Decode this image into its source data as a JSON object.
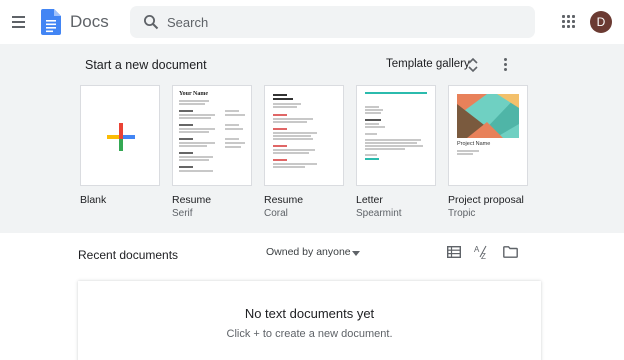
{
  "header": {
    "app_name": "Docs",
    "search_placeholder": "Search",
    "avatar_letter": "D",
    "avatar_color": "#6b3a32"
  },
  "templates": {
    "title": "Start a new document",
    "gallery_label": "Template gallery",
    "items": [
      {
        "name": "Blank",
        "sub": ""
      },
      {
        "name": "Resume",
        "sub": "Serif"
      },
      {
        "name": "Resume",
        "sub": "Coral"
      },
      {
        "name": "Letter",
        "sub": "Spearmint"
      },
      {
        "name": "Project proposal",
        "sub": "Tropic"
      }
    ],
    "thumb_text": {
      "resume_serif_name": "Your Name",
      "proposal_title": "Project Name"
    }
  },
  "recent": {
    "title": "Recent documents",
    "owner_filter": "Owned by anyone",
    "empty_title": "No text documents yet",
    "empty_sub": "Click + to create a new document."
  },
  "colors": {
    "accent_blue": "#4285f4",
    "accent_red": "#ea4335",
    "accent_yellow": "#fbbc04",
    "accent_green": "#34a853",
    "coral": "#e06666",
    "spearmint": "#2bbbad"
  },
  "icons": [
    "menu-icon",
    "docs-logo-icon",
    "search-icon",
    "apps-icon",
    "unfold-icon",
    "more-vert-icon",
    "list-view-icon",
    "sort-az-icon",
    "folder-icon"
  ]
}
